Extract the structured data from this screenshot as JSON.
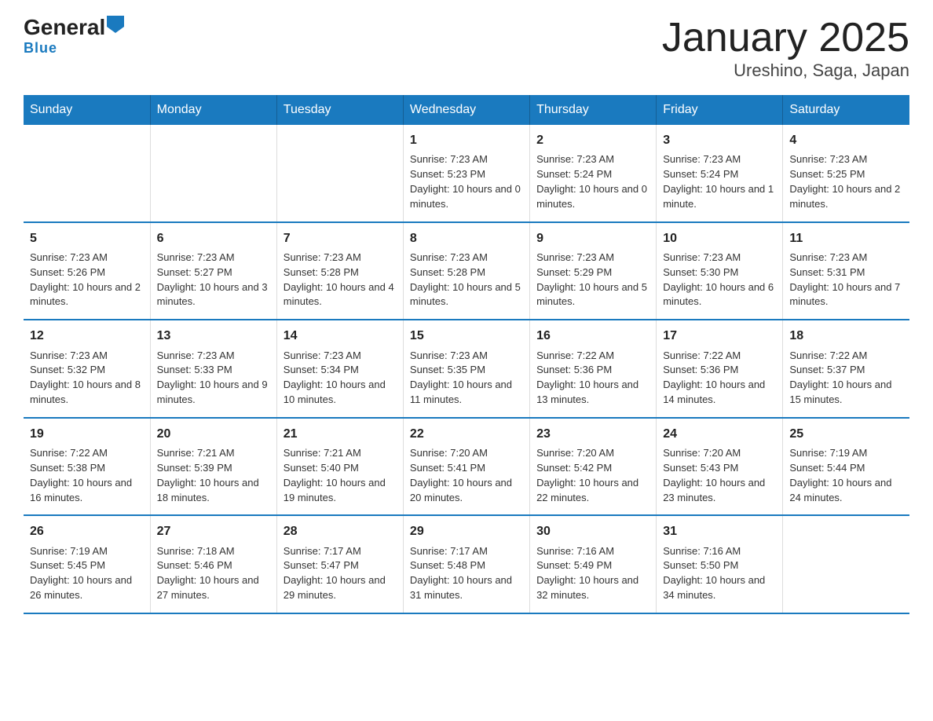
{
  "logo": {
    "text_general": "General",
    "text_blue": "Blue"
  },
  "title": "January 2025",
  "subtitle": "Ureshino, Saga, Japan",
  "days_of_week": [
    "Sunday",
    "Monday",
    "Tuesday",
    "Wednesday",
    "Thursday",
    "Friday",
    "Saturday"
  ],
  "weeks": [
    [
      {
        "day": "",
        "info": ""
      },
      {
        "day": "",
        "info": ""
      },
      {
        "day": "",
        "info": ""
      },
      {
        "day": "1",
        "info": "Sunrise: 7:23 AM\nSunset: 5:23 PM\nDaylight: 10 hours and 0 minutes."
      },
      {
        "day": "2",
        "info": "Sunrise: 7:23 AM\nSunset: 5:24 PM\nDaylight: 10 hours and 0 minutes."
      },
      {
        "day": "3",
        "info": "Sunrise: 7:23 AM\nSunset: 5:24 PM\nDaylight: 10 hours and 1 minute."
      },
      {
        "day": "4",
        "info": "Sunrise: 7:23 AM\nSunset: 5:25 PM\nDaylight: 10 hours and 2 minutes."
      }
    ],
    [
      {
        "day": "5",
        "info": "Sunrise: 7:23 AM\nSunset: 5:26 PM\nDaylight: 10 hours and 2 minutes."
      },
      {
        "day": "6",
        "info": "Sunrise: 7:23 AM\nSunset: 5:27 PM\nDaylight: 10 hours and 3 minutes."
      },
      {
        "day": "7",
        "info": "Sunrise: 7:23 AM\nSunset: 5:28 PM\nDaylight: 10 hours and 4 minutes."
      },
      {
        "day": "8",
        "info": "Sunrise: 7:23 AM\nSunset: 5:28 PM\nDaylight: 10 hours and 5 minutes."
      },
      {
        "day": "9",
        "info": "Sunrise: 7:23 AM\nSunset: 5:29 PM\nDaylight: 10 hours and 5 minutes."
      },
      {
        "day": "10",
        "info": "Sunrise: 7:23 AM\nSunset: 5:30 PM\nDaylight: 10 hours and 6 minutes."
      },
      {
        "day": "11",
        "info": "Sunrise: 7:23 AM\nSunset: 5:31 PM\nDaylight: 10 hours and 7 minutes."
      }
    ],
    [
      {
        "day": "12",
        "info": "Sunrise: 7:23 AM\nSunset: 5:32 PM\nDaylight: 10 hours and 8 minutes."
      },
      {
        "day": "13",
        "info": "Sunrise: 7:23 AM\nSunset: 5:33 PM\nDaylight: 10 hours and 9 minutes."
      },
      {
        "day": "14",
        "info": "Sunrise: 7:23 AM\nSunset: 5:34 PM\nDaylight: 10 hours and 10 minutes."
      },
      {
        "day": "15",
        "info": "Sunrise: 7:23 AM\nSunset: 5:35 PM\nDaylight: 10 hours and 11 minutes."
      },
      {
        "day": "16",
        "info": "Sunrise: 7:22 AM\nSunset: 5:36 PM\nDaylight: 10 hours and 13 minutes."
      },
      {
        "day": "17",
        "info": "Sunrise: 7:22 AM\nSunset: 5:36 PM\nDaylight: 10 hours and 14 minutes."
      },
      {
        "day": "18",
        "info": "Sunrise: 7:22 AM\nSunset: 5:37 PM\nDaylight: 10 hours and 15 minutes."
      }
    ],
    [
      {
        "day": "19",
        "info": "Sunrise: 7:22 AM\nSunset: 5:38 PM\nDaylight: 10 hours and 16 minutes."
      },
      {
        "day": "20",
        "info": "Sunrise: 7:21 AM\nSunset: 5:39 PM\nDaylight: 10 hours and 18 minutes."
      },
      {
        "day": "21",
        "info": "Sunrise: 7:21 AM\nSunset: 5:40 PM\nDaylight: 10 hours and 19 minutes."
      },
      {
        "day": "22",
        "info": "Sunrise: 7:20 AM\nSunset: 5:41 PM\nDaylight: 10 hours and 20 minutes."
      },
      {
        "day": "23",
        "info": "Sunrise: 7:20 AM\nSunset: 5:42 PM\nDaylight: 10 hours and 22 minutes."
      },
      {
        "day": "24",
        "info": "Sunrise: 7:20 AM\nSunset: 5:43 PM\nDaylight: 10 hours and 23 minutes."
      },
      {
        "day": "25",
        "info": "Sunrise: 7:19 AM\nSunset: 5:44 PM\nDaylight: 10 hours and 24 minutes."
      }
    ],
    [
      {
        "day": "26",
        "info": "Sunrise: 7:19 AM\nSunset: 5:45 PM\nDaylight: 10 hours and 26 minutes."
      },
      {
        "day": "27",
        "info": "Sunrise: 7:18 AM\nSunset: 5:46 PM\nDaylight: 10 hours and 27 minutes."
      },
      {
        "day": "28",
        "info": "Sunrise: 7:17 AM\nSunset: 5:47 PM\nDaylight: 10 hours and 29 minutes."
      },
      {
        "day": "29",
        "info": "Sunrise: 7:17 AM\nSunset: 5:48 PM\nDaylight: 10 hours and 31 minutes."
      },
      {
        "day": "30",
        "info": "Sunrise: 7:16 AM\nSunset: 5:49 PM\nDaylight: 10 hours and 32 minutes."
      },
      {
        "day": "31",
        "info": "Sunrise: 7:16 AM\nSunset: 5:50 PM\nDaylight: 10 hours and 34 minutes."
      },
      {
        "day": "",
        "info": ""
      }
    ]
  ]
}
